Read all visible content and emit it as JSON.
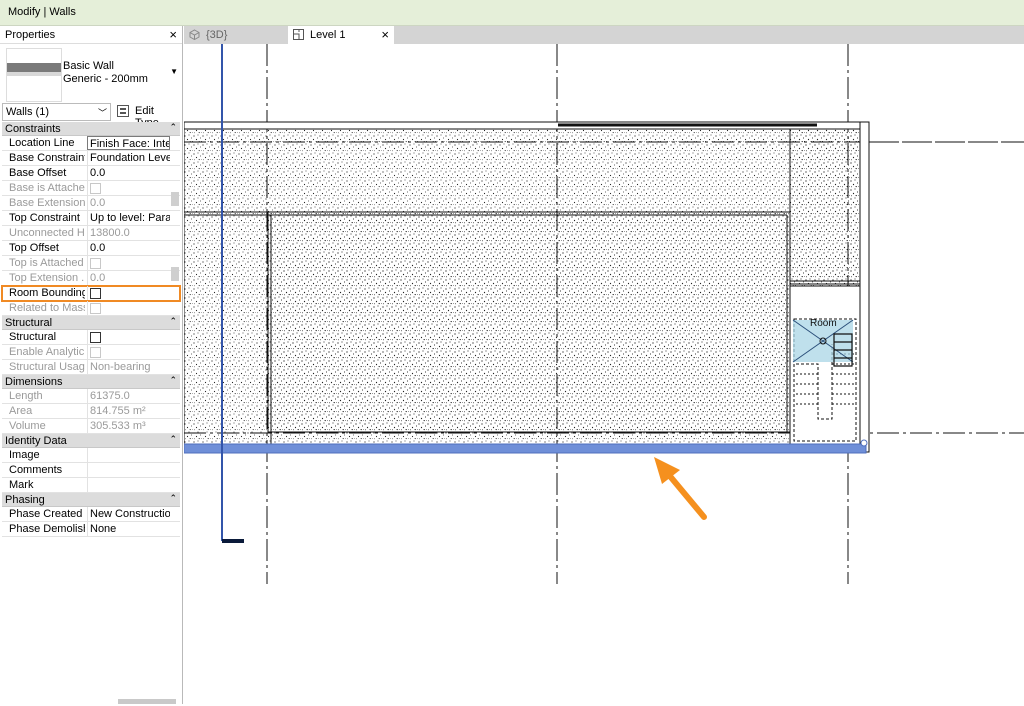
{
  "window": {
    "title": "Modify | Walls"
  },
  "properties": {
    "header": "Properties",
    "close_glyph": "×",
    "type_family": "Basic Wall",
    "type_name": "Generic - 200mm",
    "instance_filter": "Walls (1)",
    "edit_type": "Edit Type",
    "sections": [
      {
        "name": "Constraints",
        "rows": [
          {
            "key": "Location Line",
            "value": "Finish Face: Inte"
          },
          {
            "key": "Base Constraint",
            "value": "Foundation Level"
          },
          {
            "key": "Base Offset",
            "value": "0.0"
          },
          {
            "key": "Base is Attached",
            "value": ""
          },
          {
            "key": "Base Extension ...",
            "value": "0.0"
          },
          {
            "key": "Top Constraint",
            "value": "Up to level: Para..."
          },
          {
            "key": "Unconnected H...",
            "value": "13800.0"
          },
          {
            "key": "Top Offset",
            "value": "0.0"
          },
          {
            "key": "Top is Attached",
            "value": ""
          },
          {
            "key": "Top Extension ...",
            "value": "0.0"
          },
          {
            "key": "Room Bounding",
            "value": ""
          },
          {
            "key": "Related to Mass",
            "value": ""
          }
        ]
      },
      {
        "name": "Structural",
        "rows": [
          {
            "key": "Structural",
            "value": ""
          },
          {
            "key": "Enable Analytic...",
            "value": ""
          },
          {
            "key": "Structural Usage",
            "value": "Non-bearing"
          }
        ]
      },
      {
        "name": "Dimensions",
        "rows": [
          {
            "key": "Length",
            "value": "61375.0"
          },
          {
            "key": "Area",
            "value": "814.755 m²"
          },
          {
            "key": "Volume",
            "value": "305.533 m³"
          }
        ]
      },
      {
        "name": "Identity Data",
        "rows": [
          {
            "key": "Image",
            "value": ""
          },
          {
            "key": "Comments",
            "value": ""
          },
          {
            "key": "Mark",
            "value": ""
          }
        ]
      },
      {
        "name": "Phasing",
        "rows": [
          {
            "key": "Phase Created",
            "value": "New Construction"
          },
          {
            "key": "Phase Demolish...",
            "value": "None"
          }
        ]
      }
    ]
  },
  "tabs": [
    {
      "label": "{3D}",
      "active": false
    },
    {
      "label": "Level 1",
      "active": true
    }
  ],
  "canvas": {
    "room_tag": "Room",
    "selection_color": "#6f8fd8",
    "highlight_color": "#f08a24",
    "annotation_arrow_color": "#f5901e"
  }
}
